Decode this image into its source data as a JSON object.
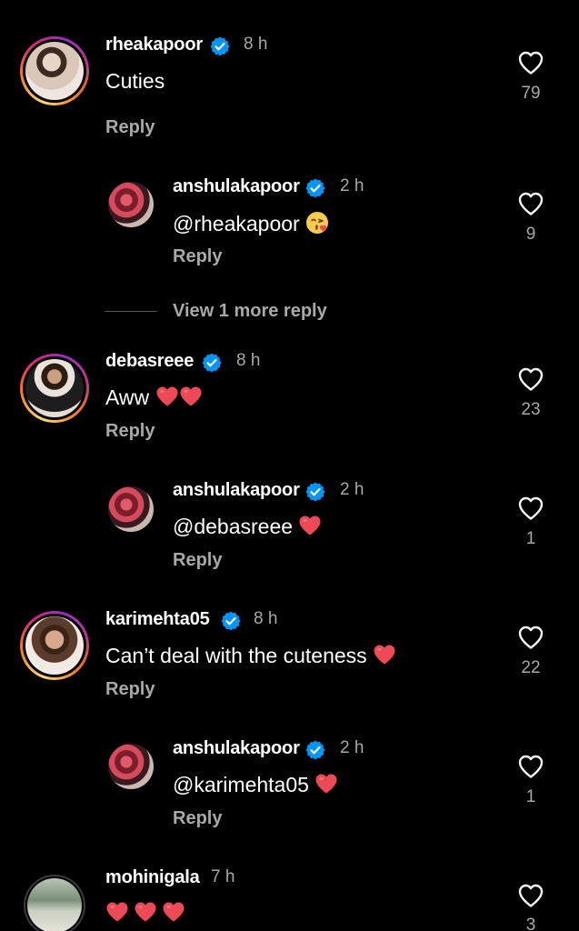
{
  "comments": [
    {
      "username": "rheakapoor",
      "verified": true,
      "time": "8 h",
      "text": "Cuties",
      "reply": "Reply",
      "likes": "79",
      "avatar": "rheakapoor-avatar"
    },
    {
      "username": "anshulakapoor",
      "verified": true,
      "time": "2 h",
      "text": "@rheakapoor",
      "emoji": "kissing-face-emoji",
      "reply": "Reply",
      "likes": "9",
      "avatar": "anshulakapoor-avatar"
    },
    {
      "username": "debasreee",
      "verified": true,
      "time": "8 h",
      "text": "Aww",
      "emoji": "red-heart-emoji x2",
      "reply": "Reply",
      "likes": "23",
      "avatar": "debasreee-avatar"
    },
    {
      "username": "anshulakapoor",
      "verified": true,
      "time": "2 h",
      "text": "@debasreee",
      "emoji": "red-heart-emoji",
      "reply": "Reply",
      "likes": "1",
      "avatar": "anshulakapoor-avatar"
    },
    {
      "username": "karimehta05",
      "verified": true,
      "time": "8 h",
      "text": "Can’t deal with the cuteness",
      "emoji": "red-heart-emoji",
      "reply": "Reply",
      "likes": "22",
      "avatar": "karimehta05-avatar"
    },
    {
      "username": "anshulakapoor",
      "verified": true,
      "time": "2 h",
      "text": "@karimehta05",
      "emoji": "red-heart-emoji",
      "reply": "Reply",
      "likes": "1",
      "avatar": "anshulakapoor-avatar"
    },
    {
      "username": "mohinigala",
      "verified": false,
      "time": "7 h",
      "text": "",
      "emoji": "red-heart-emoji x3",
      "likes": "3",
      "avatar": "mohinigala-avatar"
    }
  ],
  "view_more": "View 1 more reply",
  "colors": {
    "background": "#000000",
    "secondary_text": "#a8a8a8",
    "verified_blue": "#0095f6",
    "heart_red": "#ed4956"
  }
}
